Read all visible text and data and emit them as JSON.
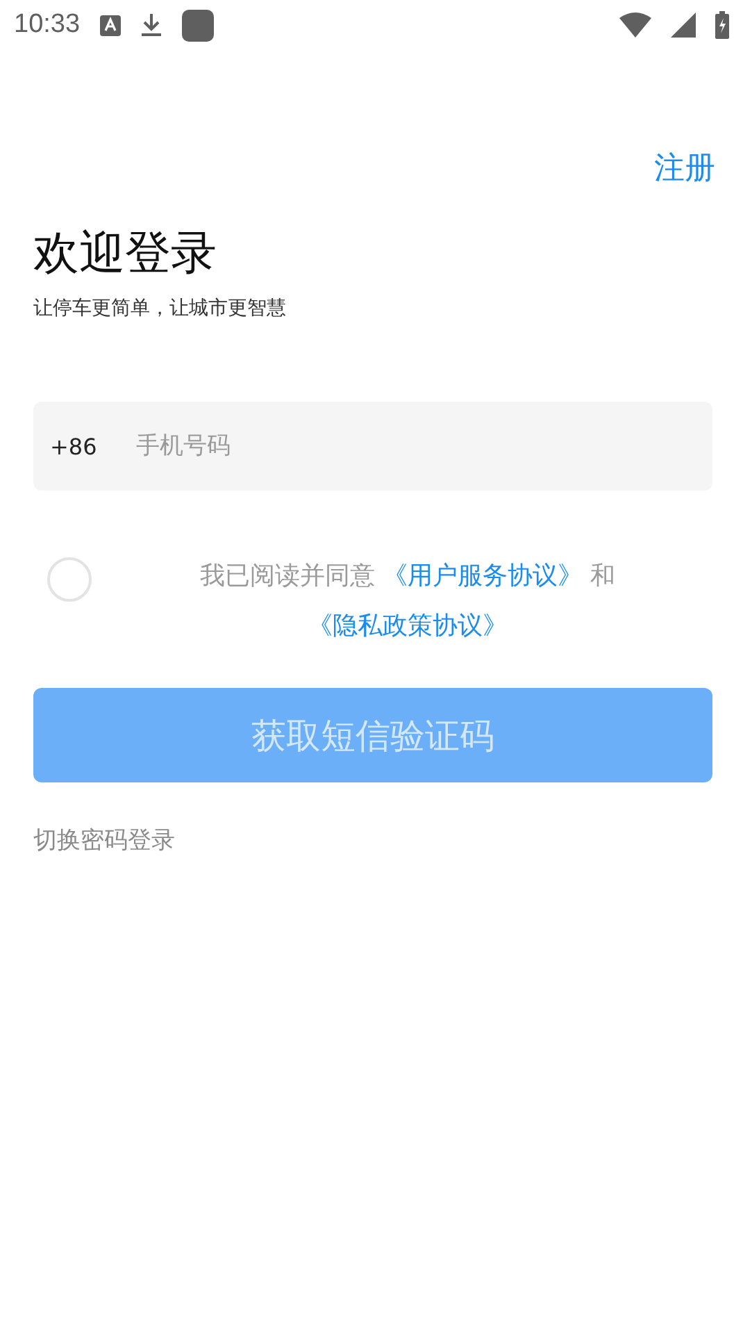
{
  "status_bar": {
    "time": "10:33"
  },
  "register_link": "注册",
  "title": "欢迎登录",
  "subtitle": "让停车更简单，让城市更智慧",
  "phone": {
    "prefix": "+86",
    "placeholder": "手机号码"
  },
  "agreement": {
    "checked": false,
    "text": "我已阅读并同意",
    "joiner": "和",
    "links": [
      "《用户服务协议》",
      "《隐私政策协议》"
    ]
  },
  "submit": {
    "label": "获取短信验证码",
    "disabled": true
  },
  "switch_link": "切换密码登录"
}
